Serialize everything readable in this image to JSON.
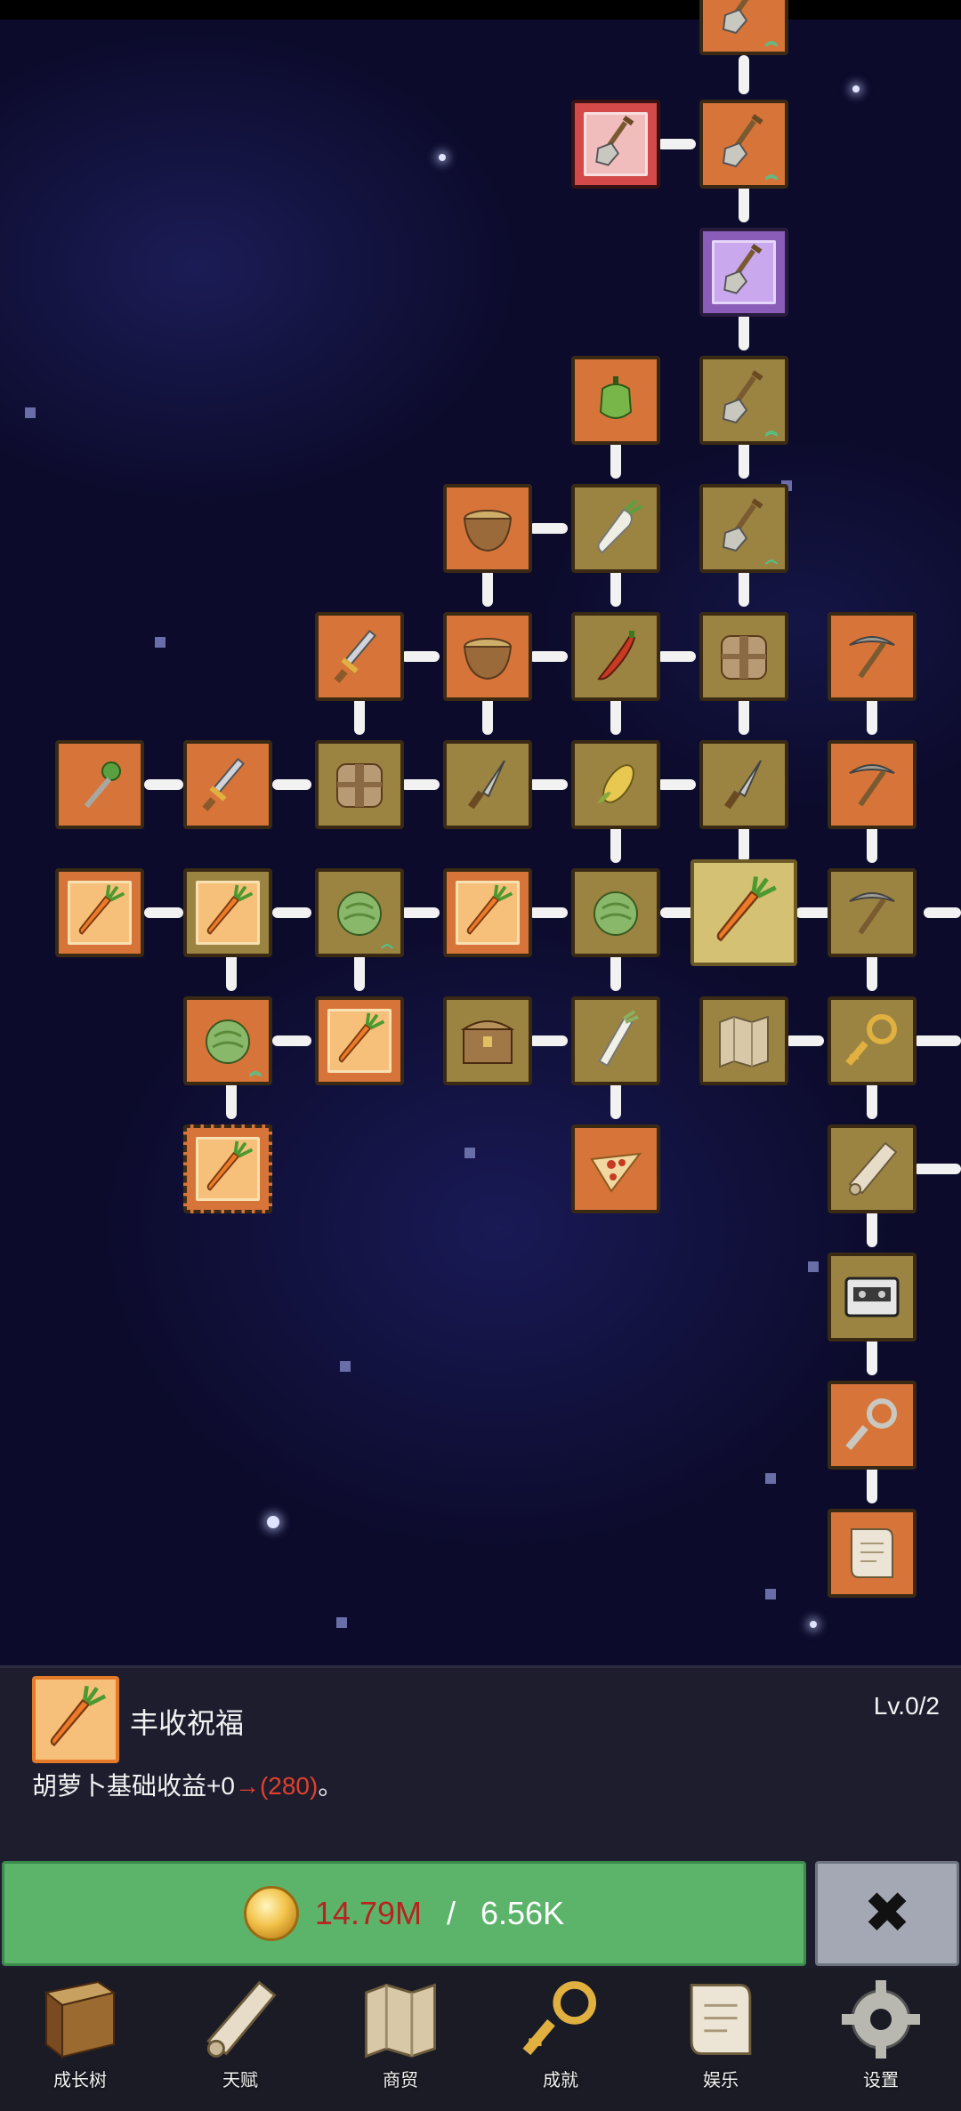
{
  "skill_detail": {
    "name": "丰收祝福",
    "level": "Lv.0/2",
    "desc_prefix": "胡萝卜基础收益+0",
    "desc_arrow": "→",
    "desc_value": "(280)",
    "desc_suffix": "。",
    "icon": "carrot-icon"
  },
  "buy": {
    "owned": "14.79M",
    "separator": " / ",
    "cost": "6.56K",
    "icon": "coin-icon"
  },
  "close": {
    "label": "✖",
    "icon": "close-icon"
  },
  "nav": {
    "items": [
      {
        "label": "成长树",
        "icon": "book-icon"
      },
      {
        "label": "天赋",
        "icon": "scroll-icon"
      },
      {
        "label": "商贸",
        "icon": "map-icon"
      },
      {
        "label": "成就",
        "icon": "key-icon"
      },
      {
        "label": "娱乐",
        "icon": "parchment-icon"
      },
      {
        "label": "设置",
        "icon": "gear-icon"
      }
    ]
  },
  "colors": {
    "node_orange": "#d7743a",
    "node_olive": "#9b8442",
    "node_purple": "#8a5db8",
    "node_red": "#d44a4a",
    "selected": "#d4c173",
    "buy_green": "#5cb46b",
    "cost_red": "#b72420",
    "highlight_red": "#e0402c"
  },
  "tree_nodes": [
    {
      "icon": "shovel-icon"
    },
    {
      "icon": "shovel-icon"
    },
    {
      "icon": "shovel-icon"
    },
    {
      "icon": "shovel-icon"
    },
    {
      "icon": "shovel-icon"
    },
    {
      "icon": "pepper-icon"
    },
    {
      "icon": "shovel-icon"
    },
    {
      "icon": "bowl-icon"
    },
    {
      "icon": "radish-icon"
    },
    {
      "icon": "sword-icon"
    },
    {
      "icon": "bowl-icon"
    },
    {
      "icon": "chili-icon"
    },
    {
      "icon": "backpack-icon"
    },
    {
      "icon": "pickaxe-icon"
    },
    {
      "icon": "wand-icon"
    },
    {
      "icon": "sword-icon"
    },
    {
      "icon": "backpack-icon"
    },
    {
      "icon": "knife-icon"
    },
    {
      "icon": "corn-icon"
    },
    {
      "icon": "knife-icon"
    },
    {
      "icon": "pickaxe-icon"
    },
    {
      "icon": "carrot-icon"
    },
    {
      "icon": "carrot-icon"
    },
    {
      "icon": "cabbage-icon"
    },
    {
      "icon": "carrot-icon"
    },
    {
      "icon": "cabbage-icon"
    },
    {
      "icon": "carrot-icon"
    },
    {
      "icon": "pickaxe-icon"
    },
    {
      "icon": "cabbage-icon"
    },
    {
      "icon": "carrot-icon"
    },
    {
      "icon": "chest-icon"
    },
    {
      "icon": "leek-icon"
    },
    {
      "icon": "map-icon"
    },
    {
      "icon": "key-icon"
    },
    {
      "icon": "carrot-icon"
    },
    {
      "icon": "pizza-icon"
    },
    {
      "icon": "scroll-icon"
    },
    {
      "icon": "tape-icon"
    },
    {
      "icon": "key-icon"
    },
    {
      "icon": "parchment-icon"
    }
  ]
}
